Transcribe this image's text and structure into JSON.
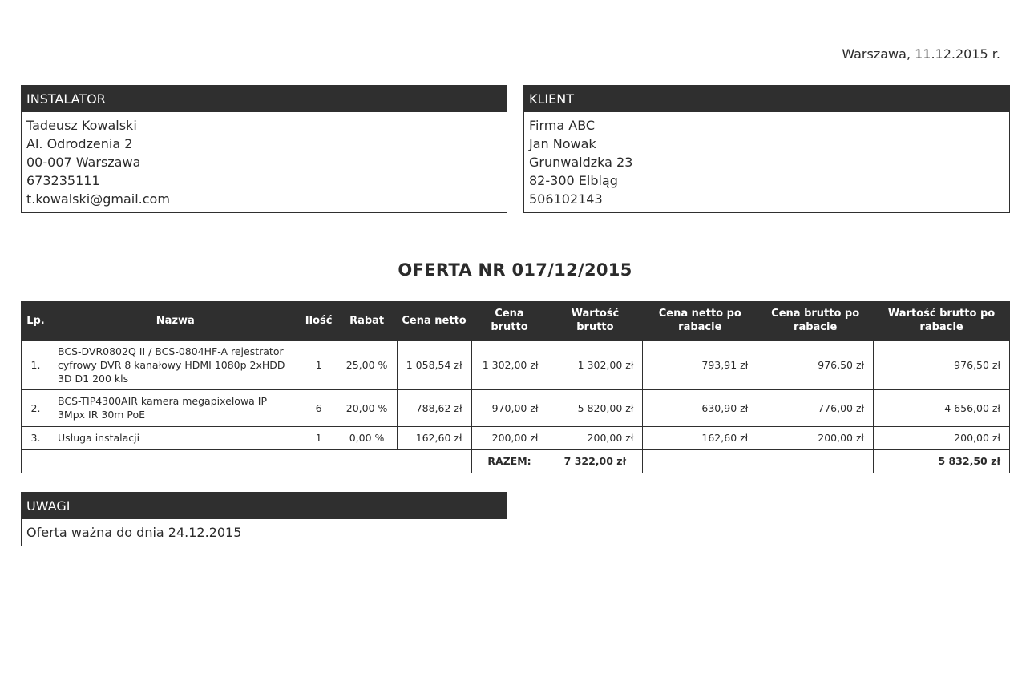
{
  "date_line": "Warszawa, 11.12.2015 r.",
  "instalator": {
    "heading": "INSTALATOR",
    "lines": [
      "Tadeusz Kowalski",
      "Al. Odrodzenia 2",
      "00-007 Warszawa",
      "673235111",
      "t.kowalski@gmail.com"
    ]
  },
  "klient": {
    "heading": "KLIENT",
    "lines": [
      "Firma ABC",
      "Jan Nowak",
      "Grunwaldzka 23",
      "82-300 Elbląg",
      "506102143"
    ]
  },
  "offer_title": "OFERTA NR 017/12/2015",
  "table": {
    "headers": [
      "Lp.",
      "Nazwa",
      "Ilość",
      "Rabat",
      "Cena netto",
      "Cena brutto",
      "Wartość brutto",
      "Cena netto po rabacie",
      "Cena brutto po rabacie",
      "Wartość brutto po rabacie"
    ],
    "rows": [
      [
        "1.",
        "BCS-DVR0802Q II / BCS-0804HF-A rejestrator cyfrowy DVR 8 kanałowy HDMI 1080p 2xHDD 3D D1 200 kls",
        "1",
        "25,00 %",
        "1 058,54 zł",
        "1 302,00 zł",
        "1 302,00 zł",
        "793,91 zł",
        "976,50 zł",
        "976,50 zł"
      ],
      [
        "2.",
        "BCS-TIP4300AIR kamera megapixelowa IP 3Mpx IR 30m PoE",
        "6",
        "20,00 %",
        "788,62 zł",
        "970,00 zł",
        "5 820,00 zł",
        "630,90 zł",
        "776,00 zł",
        "4 656,00 zł"
      ],
      [
        "3.",
        "Usługa instalacji",
        "1",
        "0,00 %",
        "162,60 zł",
        "200,00 zł",
        "200,00 zł",
        "162,60 zł",
        "200,00 zł",
        "200,00 zł"
      ]
    ],
    "total_label": "RAZEM:",
    "total_brutto": "7 322,00 zł",
    "total_brutto_po_rabacie": "5 832,50 zł"
  },
  "uwagi": {
    "heading": "UWAGI",
    "text": "Oferta ważna do dnia 24.12.2015"
  }
}
